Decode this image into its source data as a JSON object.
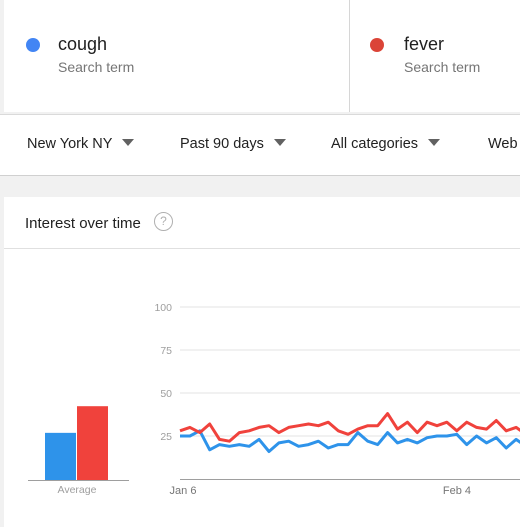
{
  "terms": [
    {
      "name": "cough",
      "sub": "Search term",
      "color": "#4285f4"
    },
    {
      "name": "fever",
      "sub": "Search term",
      "color": "#db4437"
    }
  ],
  "filters": {
    "location": "New York NY",
    "period": "Past 90 days",
    "category": "All categories",
    "search_type": "Web s"
  },
  "card": {
    "title": "Interest over time",
    "help_icon": "?"
  },
  "chart_data": [
    {
      "type": "bar",
      "categories": [
        "Average"
      ],
      "series": [
        {
          "name": "cough",
          "values": [
            23
          ],
          "color": "#2e93ea"
        },
        {
          "name": "fever",
          "values": [
            36
          ],
          "color": "#f0423c"
        }
      ],
      "xlabel": "Average"
    },
    {
      "type": "line",
      "yticks": [
        25,
        50,
        75,
        100
      ],
      "ylim": [
        0,
        100
      ],
      "xtick_labels": [
        "Jan 6",
        "Feb 4"
      ],
      "grid": true,
      "series": [
        {
          "name": "cough",
          "color": "#2e93ea",
          "values": [
            25,
            25,
            28,
            17,
            20,
            19,
            20,
            19,
            23,
            16,
            21,
            22,
            19,
            20,
            22,
            18,
            20,
            20,
            27,
            22,
            20,
            27,
            21,
            23,
            21,
            24,
            25,
            25,
            26,
            20,
            25,
            21,
            24,
            18,
            23,
            19
          ]
        },
        {
          "name": "fever",
          "color": "#f0423c",
          "values": [
            28,
            30,
            27,
            32,
            23,
            22,
            27,
            28,
            30,
            31,
            27,
            30,
            31,
            32,
            31,
            33,
            28,
            26,
            29,
            31,
            31,
            38,
            29,
            33,
            27,
            33,
            31,
            33,
            28,
            33,
            30,
            29,
            34,
            28,
            30,
            26
          ]
        }
      ]
    }
  ]
}
